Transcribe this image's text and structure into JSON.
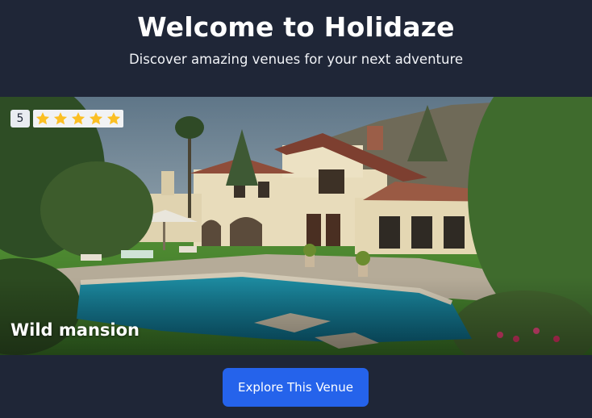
{
  "header": {
    "title": "Welcome to Holidaze",
    "subtitle": "Discover amazing venues for your next adventure"
  },
  "venue": {
    "name": "Wild mansion",
    "rating": "5",
    "rating_value": 5,
    "rating_max": 5,
    "image_description_icon": "mansion-photo"
  },
  "actions": {
    "explore_label": "Explore This Venue"
  },
  "colors": {
    "background": "#1f2637",
    "accent": "#2563eb",
    "star": "#fbbf24"
  }
}
